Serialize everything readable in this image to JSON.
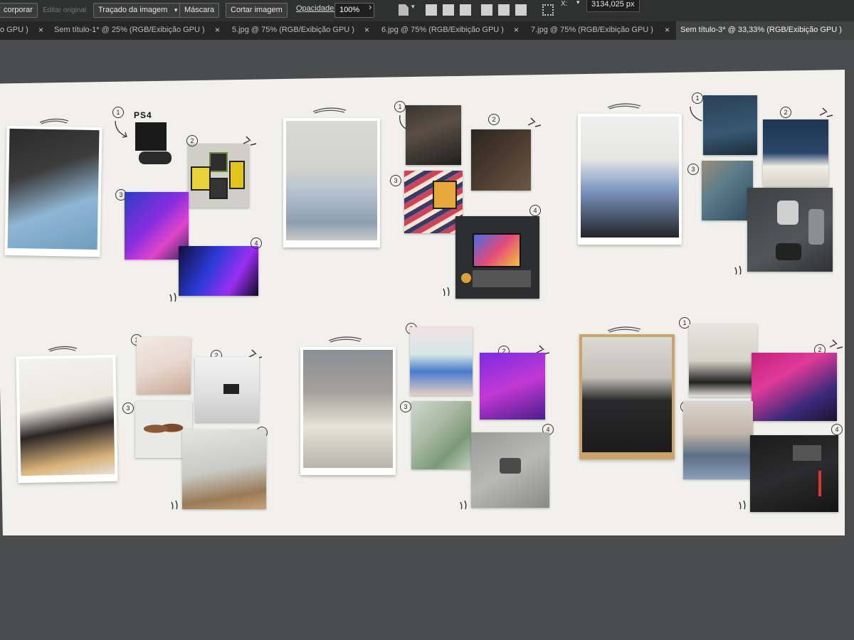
{
  "controls": {
    "incorporate_label": "corporar",
    "edit_original_label": "Editar original",
    "trace_label": "Traçado da imagem",
    "mask_label": "Máscara",
    "crop_label": "Cortar imagem",
    "opacity_label": "Opacidade:",
    "opacity_value": "100%",
    "coords_value": "3134,025 px",
    "x_label": "X:"
  },
  "tabs": [
    {
      "label": "o GPU )"
    },
    {
      "label": "Sem título-1* @ 25% (RGB/Exibição GPU )"
    },
    {
      "label": "5.jpg @ 75% (RGB/Exibição GPU )"
    },
    {
      "label": "6.jpg @ 75% (RGB/Exibição GPU )"
    },
    {
      "label": "7.jpg @ 75% (RGB/Exibição GPU )"
    },
    {
      "label": "Sem título-3* @ 33,33% (RGB/Exibição GPU )"
    }
  ],
  "tab_close_glyph": "×",
  "moodboard": {
    "ps4_label": "PS4",
    "numbers": [
      "1",
      "2",
      "3",
      "4"
    ]
  },
  "colors": {
    "app_bg": "#4b4c4d",
    "artboard": "#f1f0ec",
    "active_tab": "#414242"
  }
}
